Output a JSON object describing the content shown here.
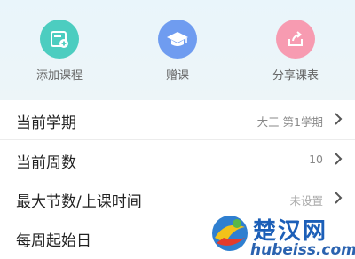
{
  "actions": [
    {
      "label": "添加课程",
      "icon": "add-course-icon",
      "color": "#4ccdc0"
    },
    {
      "label": "赠课",
      "icon": "graduation-cap-icon",
      "color": "#6f9cf0"
    },
    {
      "label": "分享课表",
      "icon": "share-icon",
      "color": "#f79bb1"
    }
  ],
  "settings": [
    {
      "title": "当前学期",
      "value": "大三  第1学期"
    },
    {
      "title": "当前周数",
      "value": "10"
    },
    {
      "title": "最大节数/上课时间",
      "value": "未设置"
    },
    {
      "title": "每周起始日",
      "value": ""
    }
  ],
  "watermark": {
    "brand": "楚汉网",
    "url": "hubeiss.com"
  },
  "colors": {
    "chevron": "#555555"
  }
}
